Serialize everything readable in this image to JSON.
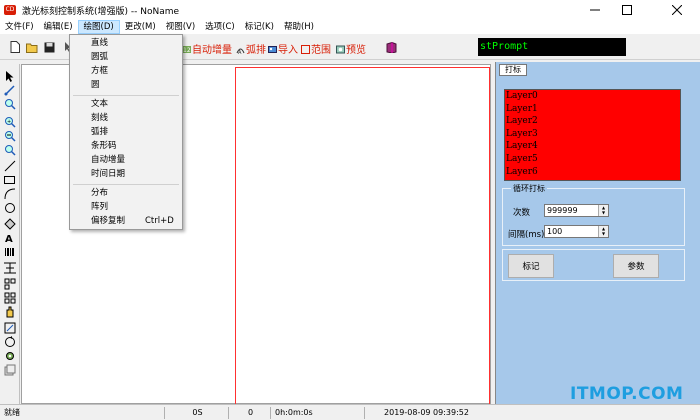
{
  "window": {
    "title": "激光标刻控制系统(增强版) -- NoName",
    "icon_text": "CD"
  },
  "menubar": [
    {
      "label": "文件(F)"
    },
    {
      "label": "编辑(E)"
    },
    {
      "label": "绘图(D)"
    },
    {
      "label": "更改(M)"
    },
    {
      "label": "视图(V)"
    },
    {
      "label": "选项(C)"
    },
    {
      "label": "标记(K)"
    },
    {
      "label": "帮助(H)"
    }
  ],
  "toolbar": {
    "text_buttons": [
      {
        "label": "自动增量"
      },
      {
        "label": "弧排"
      },
      {
        "label": "导入"
      },
      {
        "label": "范围"
      },
      {
        "label": "预览"
      }
    ],
    "prompt": "stPrompt"
  },
  "draw_menu": {
    "items": [
      {
        "label": "直线"
      },
      {
        "label": "圆弧"
      },
      {
        "label": "方框"
      },
      {
        "label": "圆"
      },
      {
        "label": "文本"
      },
      {
        "label": "刻线"
      },
      {
        "label": "弧排"
      },
      {
        "label": "条形码"
      },
      {
        "label": "自动增量"
      },
      {
        "label": "时间日期"
      },
      {
        "label": "分布"
      },
      {
        "label": "阵列"
      },
      {
        "label": "偏移复制",
        "shortcut": "Ctrl+D"
      }
    ]
  },
  "panel": {
    "tab": "打标",
    "layers": [
      "Layer0",
      "Layer1",
      "Layer2",
      "Layer3",
      "Layer4",
      "Layer5",
      "Layer6"
    ],
    "loop_group": {
      "title": "循环打标",
      "count_label": "次数",
      "count_value": "999999",
      "interval_label": "间隔(ms)",
      "interval_value": "100"
    },
    "mark_button": "标记",
    "params_button": "参数"
  },
  "status": {
    "ready": "就绪",
    "count": "0S",
    "value": "0",
    "elapsed": "0h:0m:0s",
    "datetime": "2019-08-09 09:39:52"
  },
  "watermark": "ITMOP.COM",
  "colors": {
    "layer_bg": "#ff0000",
    "panel_bg": "#a6c8ea",
    "prompt_bg": "#000000",
    "prompt_fg": "#00ff00",
    "accent_red": "#d81e06",
    "watermark": "#1e9ee0"
  }
}
